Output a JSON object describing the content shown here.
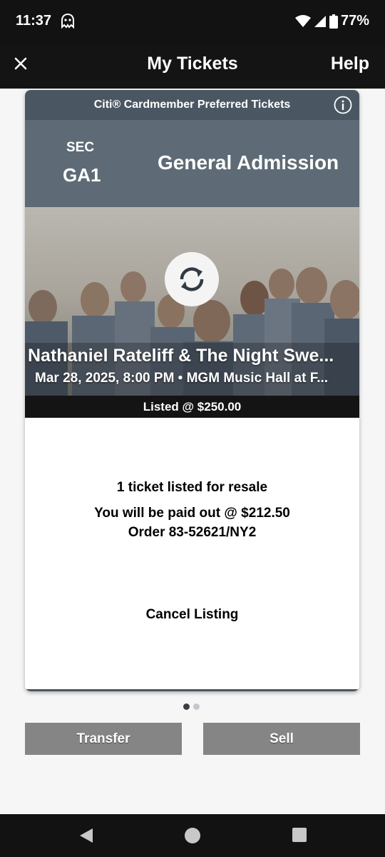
{
  "status_bar": {
    "time": "11:37",
    "battery": "77%"
  },
  "app_bar": {
    "title": "My Tickets",
    "help": "Help"
  },
  "card": {
    "header": "Citi® Cardmember Preferred Tickets",
    "sec_label": "SEC",
    "sec_value": "GA1",
    "admission": "General Admission",
    "event_title": "Nathaniel Rateliff & The Night Swe...",
    "event_subtitle": "Mar 28, 2025, 8:00 PM • MGM Music Hall at F...",
    "listed": "Listed @ $250.00",
    "resale_count": "1 ticket listed for resale",
    "payout": "You will be paid out @ $212.50",
    "order": "Order 83-52621/NY2",
    "cancel": "Cancel Listing"
  },
  "pager": {
    "count": 2,
    "active": 0
  },
  "actions": {
    "transfer": "Transfer",
    "sell": "Sell"
  },
  "colors": {
    "header": "#4a5763",
    "seat_block": "#5e6b76",
    "button": "#858585"
  },
  "icons": [
    "ghost-icon",
    "wifi-icon",
    "signal-icon",
    "battery-icon",
    "close-icon",
    "info-icon",
    "refresh-icon",
    "back-icon",
    "home-icon",
    "recents-icon"
  ]
}
